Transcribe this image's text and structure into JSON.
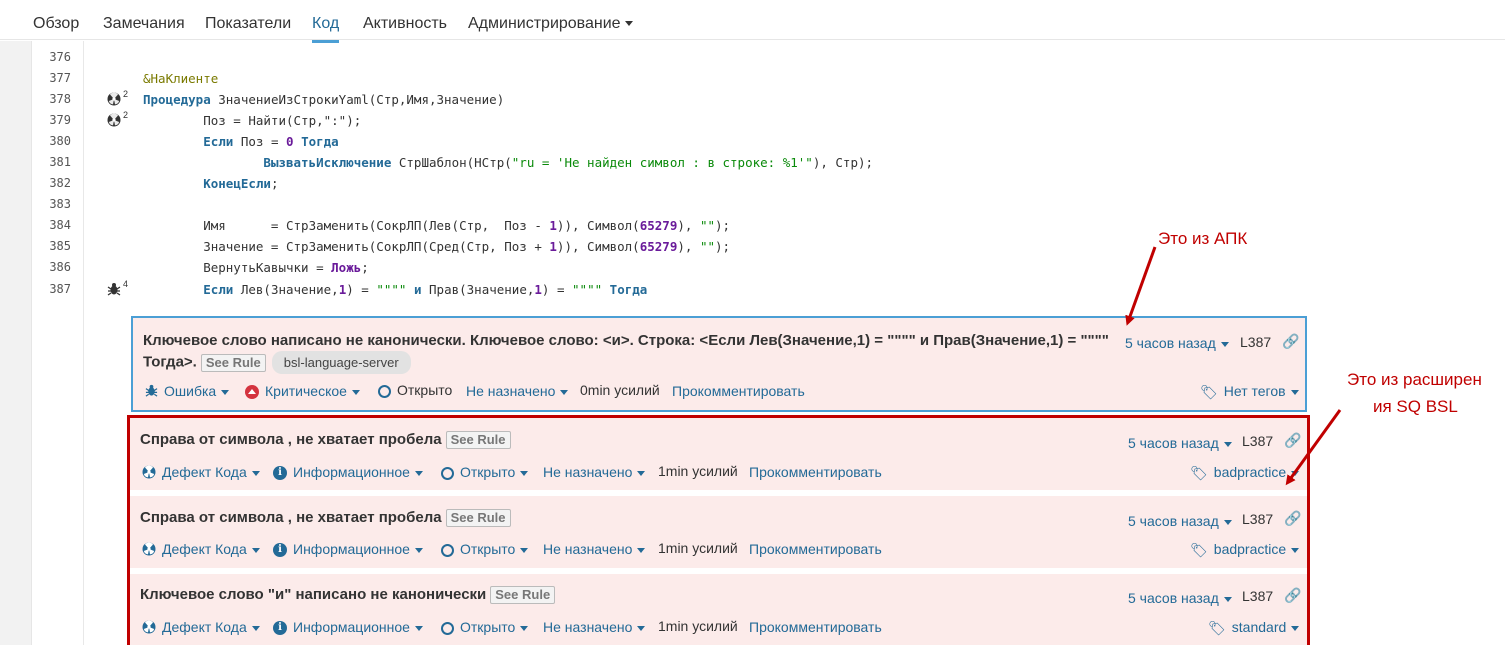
{
  "nav": {
    "items": [
      "Обзор",
      "Замечания",
      "Показатели",
      "Код",
      "Активность",
      "Администрирование"
    ],
    "active": "Код"
  },
  "code": {
    "lines": [
      {
        "num": "376",
        "marker": "",
        "count": ""
      },
      {
        "num": "377",
        "marker": "",
        "count": ""
      },
      {
        "num": "378",
        "marker": "radiation-icon",
        "count": "2"
      },
      {
        "num": "379",
        "marker": "radiation-icon",
        "count": "2"
      },
      {
        "num": "380",
        "marker": "",
        "count": ""
      },
      {
        "num": "381",
        "marker": "",
        "count": ""
      },
      {
        "num": "382",
        "marker": "",
        "count": ""
      },
      {
        "num": "383",
        "marker": "",
        "count": ""
      },
      {
        "num": "384",
        "marker": "",
        "count": ""
      },
      {
        "num": "385",
        "marker": "",
        "count": ""
      },
      {
        "num": "386",
        "marker": "",
        "count": ""
      },
      {
        "num": "387",
        "marker": "bug-icon",
        "count": "4"
      }
    ],
    "text": {
      "l377": "&НаКлиенте",
      "l378_kw": "Процедура",
      "l378_rest": " ЗначениеИзСтрокиYaml(Стр,Имя,Значение)",
      "l379": "        Поз = Найти(Стр,\":\");",
      "l380_a": "        ",
      "l380_kw1": "Если",
      "l380_b": " Поз = ",
      "l380_num": "0",
      "l380_kw2": " Тогда",
      "l381_a": "                ",
      "l381_kw": "ВызватьИсключение",
      "l381_b": " СтрШаблон(НСтр(",
      "l381_str": "\"ru = 'Не найден символ : в строке: %1'\"",
      "l381_c": "), Стр);",
      "l382_a": "        ",
      "l382_kw": "КонецЕсли",
      "l382_b": ";",
      "l384_a": "        Имя      = СтрЗаменить(СокрЛП(Лев(Стр,  Поз - ",
      "l384_n1": "1",
      "l384_b": ")), Символ(",
      "l384_n2": "65279",
      "l384_c": "), ",
      "l384_s": "\"\"",
      "l384_d": ");",
      "l385_a": "        Значение = СтрЗаменить(СокрЛП(Сред(Стр, Поз + ",
      "l385_n1": "1",
      "l385_b": ")), Символ(",
      "l385_n2": "65279",
      "l385_c": "), ",
      "l385_s": "\"\"",
      "l385_d": ");",
      "l386_a": "        ВернутьКавычки = ",
      "l386_kw": "Ложь",
      "l386_b": ";",
      "l387_a": "        ",
      "l387_kw1": "Если",
      "l387_b": " Лев(Значение,",
      "l387_n1": "1",
      "l387_c": ") = ",
      "l387_s1": "\"\"\"\"",
      "l387_kw2": " и",
      "l387_d": " Прав(Значение,",
      "l387_n2": "1",
      "l387_e": ") = ",
      "l387_s2": "\"\"\"\"",
      "l387_kw3": " Тогда"
    }
  },
  "issues": [
    {
      "title_line1": "Ключевое слово написано не канонически. Ключевое слово: <и>. Строка: <Если Лев(Значение,1) = \"\"\"\" и Прав(Значение,1) = \"\"\"\"",
      "title_line2": "Тогда>.",
      "see_rule": "See Rule",
      "engine": "bsl-language-server",
      "time": "5 часов назад",
      "line": "L387",
      "type": "Ошибка",
      "severity": "Критическое",
      "status": "Открыто",
      "assignee": "Не назначено",
      "effort": "0min усилий",
      "comment": "Прокомментировать",
      "tags": "Нет тегов"
    },
    {
      "title": "Справа от символа , не хватает пробела",
      "see_rule": "See Rule",
      "time": "5 часов назад",
      "line": "L387",
      "type": "Дефект Кода",
      "severity": "Информационное",
      "status": "Открыто",
      "assignee": "Не назначено",
      "effort": "1min усилий",
      "comment": "Прокомментировать",
      "tags": "badpractice"
    },
    {
      "title": "Справа от символа , не хватает пробела",
      "see_rule": "See Rule",
      "time": "5 часов назад",
      "line": "L387",
      "type": "Дефект Кода",
      "severity": "Информационное",
      "status": "Открыто",
      "assignee": "Не назначено",
      "effort": "1min усилий",
      "comment": "Прокомментировать",
      "tags": "badpractice"
    },
    {
      "title": "Ключевое слово \"и\" написано не канонически",
      "see_rule": "See Rule",
      "time": "5 часов назад",
      "line": "L387",
      "type": "Дефект Кода",
      "severity": "Информационное",
      "status": "Открыто",
      "assignee": "Не назначено",
      "effort": "1min усилий",
      "comment": "Прокомментировать",
      "tags": "standard"
    }
  ],
  "annotations": {
    "apk": "Это из АПК",
    "ext_line1": "Это из расширен",
    "ext_line2": "ия SQ BSL"
  },
  "colors": {
    "accent": "#236a97",
    "issue_bg": "#fcebea",
    "annotation_red": "#c00000",
    "critical": "#d4333f",
    "highlight_box_blue": "#4b9fd5"
  }
}
